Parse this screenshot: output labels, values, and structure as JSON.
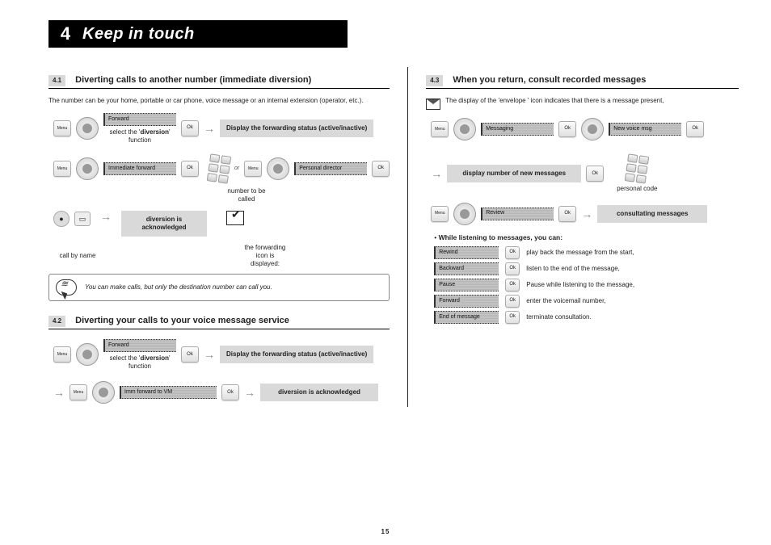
{
  "chapter": {
    "number": "4",
    "title": "Keep in touch"
  },
  "page_number": "15",
  "s41": {
    "num": "4.1",
    "title": "Diverting calls to another number (immediate diversion)",
    "intro": "The number can be your home, portable or car phone, voice message or an internal extension (operator, etc.).",
    "disp_forward": "Forward",
    "sel_diversion_pre": "select the '",
    "sel_diversion_bold": "diversion",
    "sel_diversion_post": "'\nfunction",
    "status_box": "Display the forwarding status (active/inactive)",
    "disp_immediate": "Immediate forward",
    "number_called": "number to be\ncalled",
    "or": "or",
    "disp_personal": "Personal director",
    "call_by_name": "call by name",
    "ack_box": "diversion is\nacknowledged",
    "fwd_icon_caption": "the forwarding\nicon is\ndisplayed:",
    "tip": "You can make calls, but only the destination number can call you."
  },
  "s42": {
    "num": "4.2",
    "title": "Diverting your calls to your voice message service",
    "disp_forward": "Forward",
    "sel_diversion_pre": "select the '",
    "sel_diversion_bold": "diversion",
    "sel_diversion_post": "'\nfunction",
    "status_box": "Display the forwarding status (active/inactive)",
    "disp_imm_to_vm": "Imm forward to VM",
    "ack_box": "diversion is acknowledged"
  },
  "s43": {
    "num": "4.3",
    "title": "When you return, consult recorded messages",
    "intro": "The display of the 'envelope ' icon indicates that there is a message present,",
    "disp_messaging": "Messaging",
    "disp_new_voice": "New voice msg",
    "new_msg_box": "display number of new messages",
    "personal_code": "personal code",
    "disp_review": "Review",
    "consulting_box": "consultating messages",
    "while_listening": "While listening to messages, you can:",
    "rows": [
      {
        "label": "Rewind",
        "text": "play back the message from the start,"
      },
      {
        "label": "Backward",
        "text": "listen to the end of the message,"
      },
      {
        "label": "Pause",
        "text": "Pause while listening to the message,"
      },
      {
        "label": "Forward",
        "text": "enter the voicemail number,"
      },
      {
        "label": "End of message",
        "text": "terminate consultation."
      }
    ]
  }
}
